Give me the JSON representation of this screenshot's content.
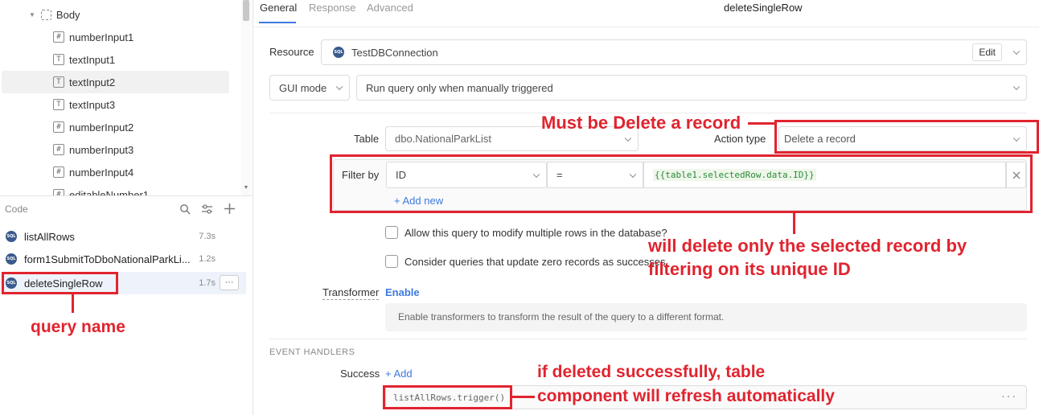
{
  "sidebar": {
    "tree": {
      "body_label": "Body",
      "items": [
        {
          "icon": "#",
          "label": "numberInput1"
        },
        {
          "icon": "T",
          "label": "textInput1"
        },
        {
          "icon": "T",
          "label": "textInput2"
        },
        {
          "icon": "T",
          "label": "textInput3"
        },
        {
          "icon": "#",
          "label": "numberInput2"
        },
        {
          "icon": "#",
          "label": "numberInput3"
        },
        {
          "icon": "#",
          "label": "numberInput4"
        },
        {
          "icon": "#",
          "label": "editableNumber1"
        }
      ]
    },
    "code": {
      "header": "Code",
      "queries": [
        {
          "name": "listAllRows",
          "time": "7.3s",
          "icon": "SQL"
        },
        {
          "name": "form1SubmitToDboNationalParkLi...",
          "time": "1.2s",
          "icon": "SQL"
        },
        {
          "name": "deleteSingleRow",
          "time": "1.7s",
          "icon": "SQL",
          "more": "···"
        }
      ]
    }
  },
  "main": {
    "tabs": [
      "General",
      "Response",
      "Advanced"
    ],
    "query_title": "deleteSingleRow",
    "resource": {
      "label": "Resource",
      "value": "TestDBConnection",
      "edit": "Edit",
      "icon": "SQL"
    },
    "mode": {
      "value": "GUI mode",
      "trigger": "Run query only when manually triggered"
    },
    "table": {
      "label": "Table",
      "value": "dbo.NationalParkList"
    },
    "action": {
      "label": "Action type",
      "value": "Delete a record"
    },
    "filter": {
      "label": "Filter by",
      "column": "ID",
      "operator": "=",
      "value": "{{table1.selectedRow.data.ID}}",
      "add": "+ Add new"
    },
    "options": [
      "Allow this query to modify multiple rows in the database?",
      "Consider queries that update zero records as successes"
    ],
    "transformer": {
      "label": "Transformer",
      "enable": "Enable",
      "hint": "Enable transformers to transform the result of the query to a different format."
    },
    "events": {
      "header": "EVENT HANDLERS",
      "success_label": "Success",
      "add": "+ Add",
      "handler": "listAllRows.trigger()",
      "more": "···"
    }
  },
  "annotations": {
    "action": "Must be Delete a record",
    "filter_line1": "will delete only the selected record by",
    "filter_line2": "filtering on its unique ID",
    "query": "query name",
    "success_line1": "if deleted successfully, table",
    "success_line2": "component will refresh automatically"
  },
  "colors": {
    "annotation": "#e0242f",
    "accent": "#3c7ae0"
  }
}
